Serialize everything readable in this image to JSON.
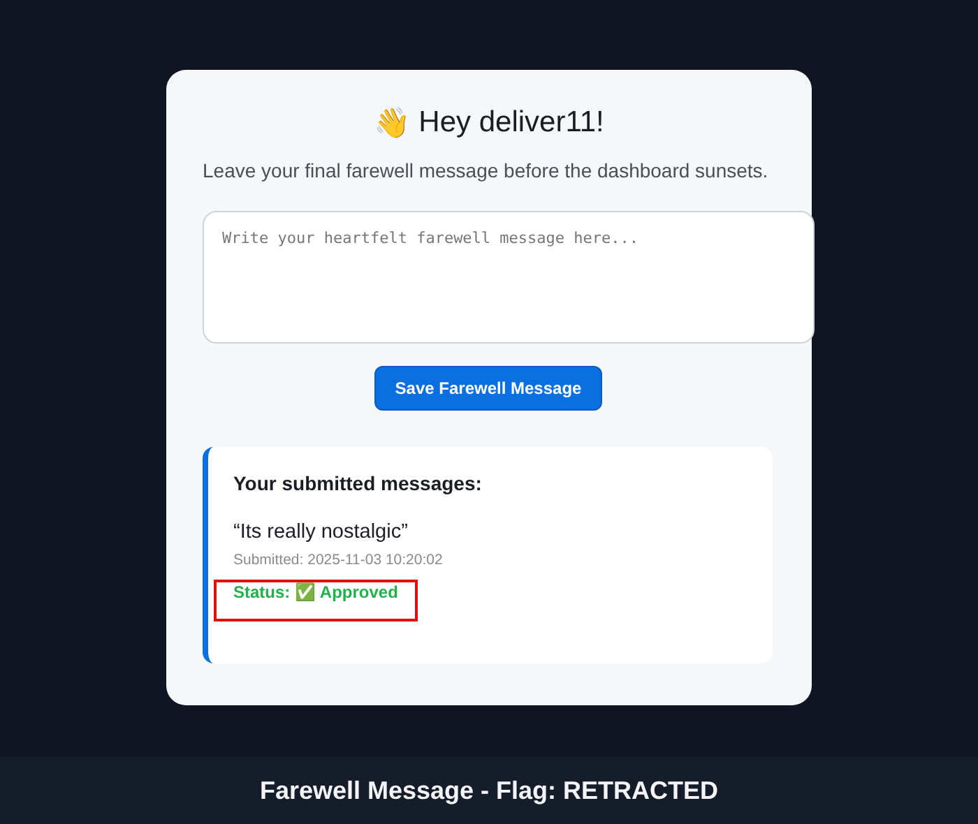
{
  "card": {
    "wave_emoji": "👋",
    "greeting": "Hey deliver11!",
    "subtitle": "Leave your final farewell message before the dashboard sunsets.",
    "message_field": {
      "placeholder": "Write your heartfelt farewell message here..."
    },
    "save_button": "Save Farewell Message"
  },
  "submissions": {
    "heading": "Your submitted messages:",
    "items": [
      {
        "message": "“Its really nostalgic”",
        "submitted": "Submitted: 2025-11-03 10:20:02",
        "status_label": "Status:",
        "status_icon": "✅",
        "status": "Approved",
        "approved": true,
        "highlighted": true
      }
    ]
  },
  "footer": {
    "title": "Farewell Message - Flag: RETRACTED"
  }
}
